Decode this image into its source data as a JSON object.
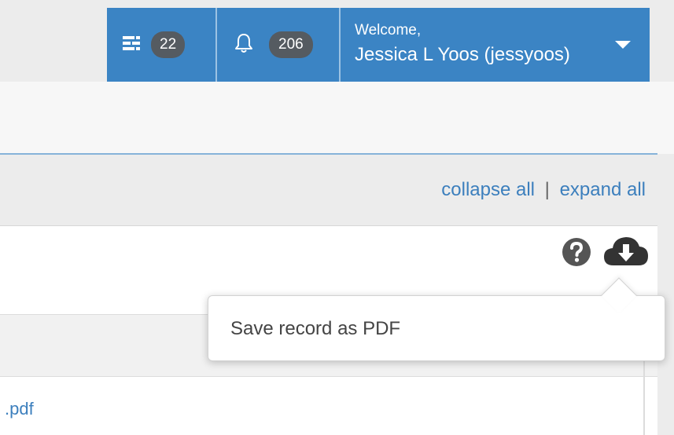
{
  "header": {
    "tasks": {
      "icon": "task-list-icon",
      "count": "22"
    },
    "alerts": {
      "icon": "bell-icon",
      "count": "206"
    },
    "user": {
      "welcome": "Welcome,",
      "name": "Jessica L Yoos (jessyoos)",
      "caret_icon": "caret-down-icon"
    },
    "accent_color": "#3b84c4"
  },
  "toolbar": {
    "collapse_all": "collapse all",
    "separator": "|",
    "expand_all": "expand all"
  },
  "record_actions": {
    "help_icon": "question-circle-icon",
    "download_icon": "cloud-download-icon",
    "tooltip": "Save record as PDF"
  },
  "attachments": {
    "file_label": ".pdf"
  }
}
